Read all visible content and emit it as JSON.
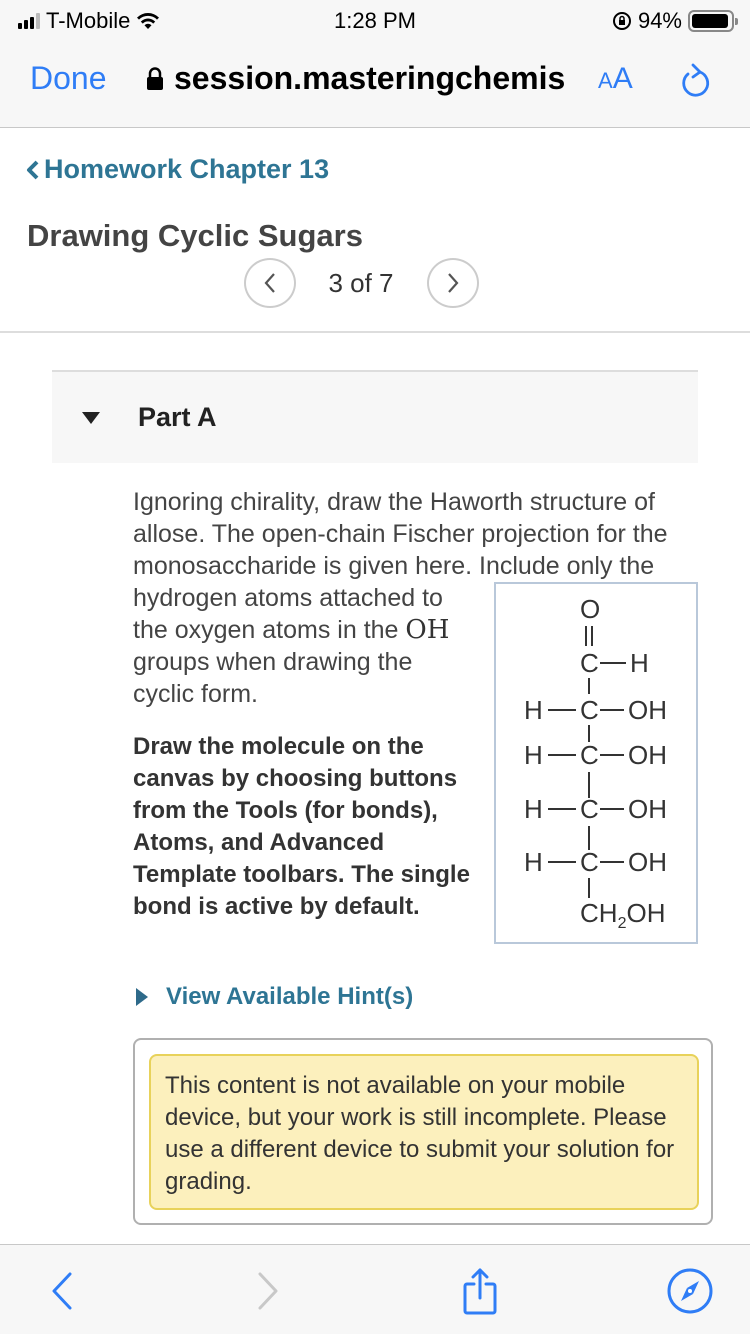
{
  "status_bar": {
    "carrier": "T-Mobile",
    "time": "1:28 PM",
    "battery_percent": "94%",
    "battery_level": 0.94,
    "signal_bars_active": 3,
    "signal_bars_total": 4
  },
  "browser": {
    "done_label": "Done",
    "url": "session.masteringchemis",
    "aa_small": "A",
    "aa_large": "A",
    "accent_color": "#2f7df6"
  },
  "header": {
    "back_label": "Homework Chapter 13",
    "title": "Drawing Cyclic Sugars",
    "pager_text": "3 of 7"
  },
  "part": {
    "label": "Part A"
  },
  "question": {
    "intro": "Ignoring chirality, draw the Haworth structure of allose. The open-chain Fischer projection for the monosaccharide is given here. Include only the",
    "wrap_before_oh": "hydrogen atoms attached to the oxygen atoms in the ",
    "oh": "OH",
    "wrap_after_oh": " groups when drawing the cyclic form.",
    "instructions": "Draw the molecule on the canvas by choosing buttons from the Tools (for bonds), Atoms, and Advanced Template toolbars. The single bond is active by default."
  },
  "fischer": {
    "top_o": "O",
    "c1_c": "C",
    "c1_h": "H",
    "rows": [
      {
        "left": "H",
        "center": "C",
        "right": "OH"
      },
      {
        "left": "H",
        "center": "C",
        "right": "OH"
      },
      {
        "left": "H",
        "center": "C",
        "right": "OH"
      },
      {
        "left": "H",
        "center": "C",
        "right": "OH"
      }
    ],
    "bottom_ch": "CH",
    "bottom_sub": "2",
    "bottom_oh": "OH"
  },
  "hints": {
    "label": "View Available Hint(s)"
  },
  "notice": {
    "text": "This content is not available on your mobile device, but your work is still incomplete. Please use a different device to submit your solution for grading."
  },
  "toolbar": {
    "back_icon": "chevron-left-icon",
    "forward_icon": "chevron-right-icon",
    "share_icon": "share-icon",
    "safari_icon": "compass-icon"
  }
}
